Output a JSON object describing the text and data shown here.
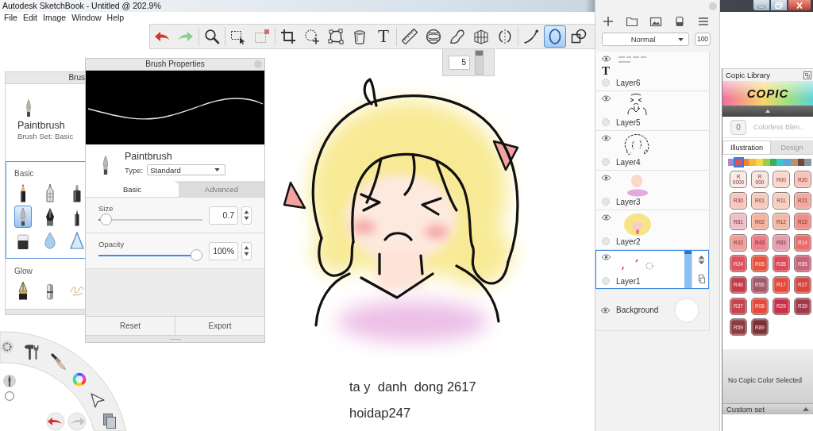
{
  "window": {
    "title": "Autodesk SketchBook - Untitled @ 202.9%"
  },
  "menu": [
    "File",
    "Edit",
    "Image",
    "Window",
    "Help"
  ],
  "toolbar": {
    "groups": [
      [
        {
          "kind": "undo",
          "selected": false
        },
        {
          "kind": "redo",
          "selected": false
        }
      ],
      [
        {
          "kind": "zoom",
          "selected": false
        }
      ],
      [
        {
          "kind": "select",
          "selected": false
        },
        {
          "kind": "deselect",
          "selected": false
        }
      ],
      [
        {
          "kind": "crop",
          "selected": false
        },
        {
          "kind": "move",
          "selected": false
        },
        {
          "kind": "distort",
          "selected": false
        },
        {
          "kind": "fill",
          "selected": false
        },
        {
          "kind": "text",
          "label": "T",
          "selected": false
        }
      ],
      [
        {
          "kind": "ruler",
          "selected": false
        },
        {
          "kind": "ellipseguide",
          "selected": false
        },
        {
          "kind": "curve",
          "selected": false
        },
        {
          "kind": "perspective",
          "selected": false
        },
        {
          "kind": "symmetry",
          "selected": false
        }
      ],
      [
        {
          "kind": "stroke",
          "selected": false
        },
        {
          "kind": "ellipse",
          "selected": true
        },
        {
          "kind": "shapes",
          "selected": false
        }
      ]
    ]
  },
  "size_popup": {
    "value": "5",
    "level": 1
  },
  "brush_library": {
    "title": "Brus",
    "current": {
      "name": "Paintbrush",
      "set": "Brush Set: Basic"
    },
    "sets": [
      {
        "name": "Basic",
        "selected": true,
        "brushes": [
          {
            "kind": "pencil",
            "selected": false
          },
          {
            "kind": "pen",
            "selected": false
          },
          {
            "kind": "marker",
            "selected": false
          },
          {
            "kind": "paintbrush",
            "selected": true
          },
          {
            "kind": "nib",
            "selected": false
          },
          {
            "kind": "felt",
            "selected": false
          },
          {
            "kind": "eraser",
            "selected": false
          },
          {
            "kind": "drop",
            "selected": false
          },
          {
            "kind": "triangle",
            "selected": false
          }
        ]
      },
      {
        "name": "Glow",
        "selected": false,
        "brushes": [
          {
            "kind": "glowpen",
            "selected": false
          },
          {
            "kind": "glowmarker",
            "selected": false
          },
          {
            "kind": "glowscribble",
            "selected": false
          }
        ]
      }
    ]
  },
  "brush_properties": {
    "title": "Brush Properties",
    "brush": "Paintbrush",
    "type_label": "Type:",
    "type": "Standard",
    "tabs": [
      {
        "label": "Basic",
        "selected": true
      },
      {
        "label": "Advanced",
        "selected": false
      }
    ],
    "sliders": [
      {
        "label": "Size",
        "value": "0.7",
        "level": 0.02
      },
      {
        "label": "Opacity",
        "value": "100%",
        "level": 1
      }
    ],
    "buttons": [
      "Reset",
      "Export"
    ]
  },
  "canvas": {
    "lines": [
      "ta y  danh  dong 2617",
      "hoidap247"
    ]
  },
  "layers": {
    "blend_mode": "Normal",
    "opacity": "100",
    "items": [
      {
        "name": "Layer6",
        "kind": "text",
        "glyph": "T",
        "selected": false
      },
      {
        "name": "Layer5",
        "kind": "lineface",
        "selected": false
      },
      {
        "name": "Layer4",
        "kind": "linehair",
        "selected": false
      },
      {
        "name": "Layer3",
        "kind": "skin",
        "selected": false
      },
      {
        "name": "Layer2",
        "kind": "hair",
        "selected": false
      },
      {
        "name": "Layer1",
        "kind": "marks",
        "selected": true
      }
    ],
    "background": "Background"
  },
  "copic": {
    "title": "Copic Library",
    "logo": "COPIC",
    "colorless": {
      "code": "0",
      "name": "Colorless Blen.."
    },
    "tabs": [
      {
        "label": "Illustration",
        "selected": true
      },
      {
        "label": "Design",
        "selected": false
      }
    ],
    "families": [
      {
        "color": "#a98bc2",
        "selected": false
      },
      {
        "color": "#e0525b",
        "selected": true
      },
      {
        "color": "#f07f3c",
        "selected": false
      },
      {
        "color": "#f5b63a",
        "selected": false
      },
      {
        "color": "#f3d84a",
        "selected": false
      },
      {
        "color": "#9ccc4a",
        "selected": false
      },
      {
        "color": "#3fae5a",
        "selected": false
      },
      {
        "color": "#3fc6c8",
        "selected": false
      },
      {
        "color": "#5aa8d8",
        "selected": false
      },
      {
        "color": "#b8946e",
        "selected": false
      },
      {
        "color": "#6e4a3a",
        "selected": false
      },
      {
        "color": "#8a96a0",
        "selected": false
      }
    ],
    "swatches": [
      {
        "label": "R\n0000",
        "color": "#f8ece8"
      },
      {
        "label": "R\n000",
        "color": "#f6e4de"
      },
      {
        "label": "R00",
        "color": "#f9d9cf"
      },
      {
        "label": "R20",
        "color": "#f8c4ba"
      },
      {
        "label": "R30",
        "color": "#f6c7bf"
      },
      {
        "label": "R01",
        "color": "#f5cbbd"
      },
      {
        "label": "R11",
        "color": "#f6cfc0"
      },
      {
        "label": "R21",
        "color": "#f3a89c"
      },
      {
        "label": "R81",
        "color": "#f1bfc8"
      },
      {
        "label": "R02",
        "color": "#f2b49f"
      },
      {
        "label": "R12",
        "color": "#f3b9a4"
      },
      {
        "label": "R22",
        "color": "#ee8e86"
      },
      {
        "label": "R32",
        "color": "#ef9f99"
      },
      {
        "label": "R43",
        "color": "#ec7c87"
      },
      {
        "label": "R83",
        "color": "#e49db1"
      },
      {
        "label": "R14",
        "color": "#ea6c6d"
      },
      {
        "label": "R24",
        "color": "#e0525b"
      },
      {
        "label": "R05",
        "color": "#e6543f"
      },
      {
        "label": "R35",
        "color": "#dc4a5a"
      },
      {
        "label": "R85",
        "color": "#c9637a"
      },
      {
        "label": "R46",
        "color": "#c23c4a"
      },
      {
        "label": "R56",
        "color": "#a3596a"
      },
      {
        "label": "R17",
        "color": "#e24a3c"
      },
      {
        "label": "R27",
        "color": "#d5473f"
      },
      {
        "label": "R37",
        "color": "#c9424f"
      },
      {
        "label": "R08",
        "color": "#e34a3a"
      },
      {
        "label": "R29",
        "color": "#c9304a"
      },
      {
        "label": "R39",
        "color": "#a33848"
      },
      {
        "label": "R59",
        "color": "#8e3c42"
      },
      {
        "label": "R89",
        "color": "#7a3235"
      }
    ],
    "status": "No Copic Color Selected",
    "custom_set": "Custom set"
  }
}
